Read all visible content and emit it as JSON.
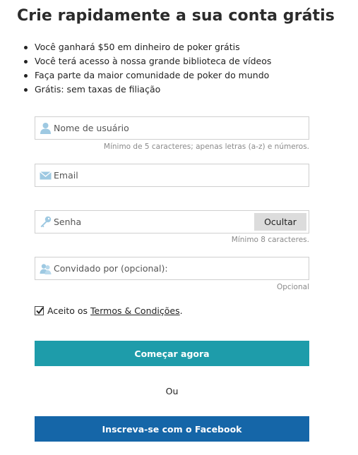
{
  "title": "Crie rapidamente a sua conta grátis",
  "benefits": [
    "Você ganhará $50 em dinheiro de poker grátis",
    "Você terá acesso à nossa grande biblioteca de vídeos",
    "Faça parte da maior comunidade de poker do mundo",
    "Grátis: sem taxas de filiação"
  ],
  "form": {
    "username": {
      "placeholder": "Nome de usuário",
      "hint": "Mínimo de 5 caracteres; apenas letras (a-z) e números."
    },
    "email": {
      "placeholder": "Email"
    },
    "password": {
      "placeholder": "Senha",
      "toggle_label": "Ocultar",
      "hint": "Mínimo 8 caracteres."
    },
    "referrer": {
      "placeholder": "Convidado por (opcional):",
      "hint": "Opcional"
    },
    "terms": {
      "prefix": "Aceito os",
      "link": "Termos & Condições",
      "suffix": ".",
      "checked": true
    },
    "submit_label": "Começar agora",
    "or_label": "Ou",
    "facebook_label": "Inscreva-se com o Facebook"
  },
  "colors": {
    "icon": "#9ec9e2",
    "primary_button": "#1e9caa",
    "facebook_button": "#1566a8"
  },
  "icons": {
    "username": "user-icon",
    "email": "envelope-icon",
    "password": "key-icon",
    "referrer": "users-icon"
  }
}
